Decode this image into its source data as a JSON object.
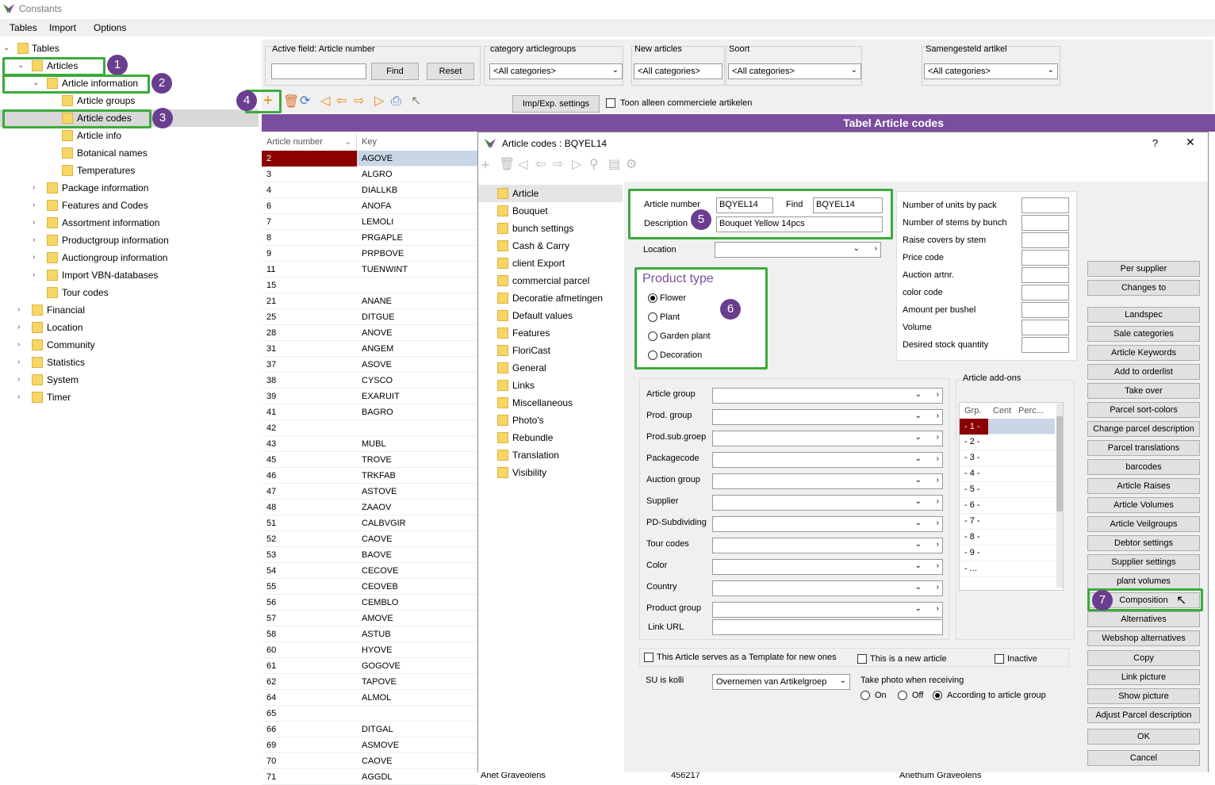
{
  "window": {
    "title": "Constants"
  },
  "menu": {
    "tables": "Tables",
    "import": "Import",
    "options": "Options"
  },
  "tree": {
    "root": "Tables",
    "articles": "Articles",
    "article_information": "Article information",
    "article_groups": "Article groups",
    "article_codes": "Article codes",
    "article_info": "Article info",
    "botanical_names": "Botanical names",
    "temperatures": "Temperatures",
    "package_information": "Package information",
    "features_and_codes": "Features and Codes",
    "assortment_information": "Assortment information",
    "productgroup_information": "Productgroup information",
    "auctiongroup_information": "Auctiongroup information",
    "import_vbn": "Import VBN-databases",
    "tour_codes": "Tour codes",
    "financial": "Financial",
    "location": "Location",
    "community": "Community",
    "statistics": "Statistics",
    "system": "System",
    "timer": "Timer"
  },
  "badges": {
    "b1": "1",
    "b2": "2",
    "b3": "3",
    "b4": "4",
    "b5": "5",
    "b6": "6",
    "b7": "7"
  },
  "filters": {
    "active_field": "Active field: Article number",
    "find": "Find",
    "reset": "Reset",
    "category_label": "category articlegroups",
    "category_value": "<All categories>",
    "new_label": "New articles",
    "new_value": "<All categories>",
    "soort_label": "Soort",
    "soort_value": "<All categories>",
    "samengesteld_label": "Samengesteld artikel",
    "samengesteld_value": "<All categories>",
    "impexp": "Imp/Exp. settings",
    "commercial": "Toon alleen commerciele artikelen"
  },
  "banner": "Tabel Article codes",
  "grid": {
    "col_number": "Article number",
    "col_key": "Key",
    "rows": [
      [
        "2",
        "AGOVE"
      ],
      [
        "3",
        "ALGRO"
      ],
      [
        "4",
        "DIALLKB"
      ],
      [
        "6",
        "ANOFA"
      ],
      [
        "7",
        "LEMOLI"
      ],
      [
        "8",
        "PRGAPLE"
      ],
      [
        "9",
        "PRPBOVE"
      ],
      [
        "11",
        "TUENWINT"
      ],
      [
        "15",
        ""
      ],
      [
        "21",
        "ANANE"
      ],
      [
        "25",
        "DITGUE"
      ],
      [
        "28",
        "ANOVE"
      ],
      [
        "31",
        "ANGEM"
      ],
      [
        "37",
        "ASOVE"
      ],
      [
        "38",
        "CYSCO"
      ],
      [
        "39",
        "EXARUIT"
      ],
      [
        "41",
        "BAGRO"
      ],
      [
        "42",
        ""
      ],
      [
        "43",
        "MUBL"
      ],
      [
        "45",
        "TROVE"
      ],
      [
        "46",
        "TRKFAB"
      ],
      [
        "47",
        "ASTOVE"
      ],
      [
        "48",
        "ZAAOV"
      ],
      [
        "51",
        "CALBVGIR"
      ],
      [
        "52",
        "CAOVE"
      ],
      [
        "53",
        "BAOVE"
      ],
      [
        "54",
        "CECOVE"
      ],
      [
        "55",
        "CEOVEB"
      ],
      [
        "56",
        "CEMBLO"
      ],
      [
        "57",
        "AMOVE"
      ],
      [
        "58",
        "ASTUB"
      ],
      [
        "60",
        "HYOVE"
      ],
      [
        "61",
        "GOGOVE"
      ],
      [
        "62",
        "TAPOVE"
      ],
      [
        "64",
        "ALMOL"
      ],
      [
        "65",
        ""
      ],
      [
        "66",
        "DITGAL"
      ],
      [
        "69",
        "ASMOVE"
      ],
      [
        "70",
        "CAOVE"
      ],
      [
        "71",
        "AGGDL"
      ]
    ]
  },
  "dialog": {
    "title": "Article codes : BQYEL14",
    "help": "?",
    "close": "✕",
    "nav": [
      "Article",
      "Bouquet",
      "bunch settings",
      "Cash & Carry",
      "client Export",
      "commercial parcel",
      "Decoratie afmetingen",
      "Default values",
      "Features",
      "FloriCast",
      "General",
      "Links",
      "Miscellaneous",
      "Photo's",
      "Rebundle",
      "Translation",
      "Visibility"
    ],
    "article_number_label": "Article number",
    "article_number": "BQYEL14",
    "find_label": "Find",
    "find_value": "BQYEL14",
    "description_label": "Description",
    "description": "Bouquet Yellow 14pcs",
    "location_label": "Location",
    "product_type": "Product type",
    "pt_flower": "Flower",
    "pt_plant": "Plant",
    "pt_garden": "Garden plant",
    "pt_decoration": "Decoration",
    "numbers": [
      "Number of units by pack",
      "Number of stems by bunch",
      "Raise covers by stem",
      "Price code",
      "Auction artnr.",
      "color code",
      "Amount per bushel",
      "Volume",
      "Desired stock quantity"
    ],
    "fields": [
      "Article group",
      "Prod. group",
      "Prod.sub.groep",
      "Packagecode",
      "Auction group",
      "Supplier",
      "PD-Subdividing",
      "Tour codes",
      "Color",
      "Country",
      "Product group"
    ],
    "link_url": "Link URL",
    "addons_title": "Article add-ons",
    "addons_cols": [
      "Grp.",
      "Cent",
      "Perc..."
    ],
    "addons_rows": [
      "- 1 -",
      "- 2 -",
      "- 3 -",
      "- 4 -",
      "- 5 -",
      "- 6 -",
      "- 7 -",
      "- 8 -",
      "- 9 -",
      "- ..."
    ],
    "template_chk": "This Article serves as a Template for new ones",
    "new_chk": "This is a new article",
    "inactive_chk": "Inactive",
    "su_label": "SU is kolli",
    "su_value": "Overnemen van Artikelgroep",
    "photo_label": "Take photo when receiving",
    "photo_on": "On",
    "photo_off": "Off",
    "photo_group": "According to article group",
    "buttons": [
      "Per supplier",
      "Changes to",
      "Landspec",
      "Sale categories",
      "Article Keywords",
      "Add to orderlist",
      "Take over",
      "Parcel sort-colors",
      "Change parcel description",
      "Parcel translations",
      "barcodes",
      "Article Raises",
      "Article Volumes",
      "Article Veilgroups",
      "Debtor settings",
      "Supplier settings",
      "plant volumes",
      "Composition",
      "Alternatives",
      "Webshop alternatives",
      "Copy",
      "Link picture",
      "Show picture",
      "Adjust Parcel description"
    ],
    "ok": "OK",
    "cancel": "Cancel"
  },
  "under_dialog": {
    "a": "Anet Graveolens",
    "b": "456217",
    "c": "Anethum Graveolens"
  },
  "colors": {
    "accent": "#7a4e9e",
    "highlight_green": "#3caa3c",
    "selected_row": "#8b0000",
    "badge": "#6a3e8e"
  }
}
